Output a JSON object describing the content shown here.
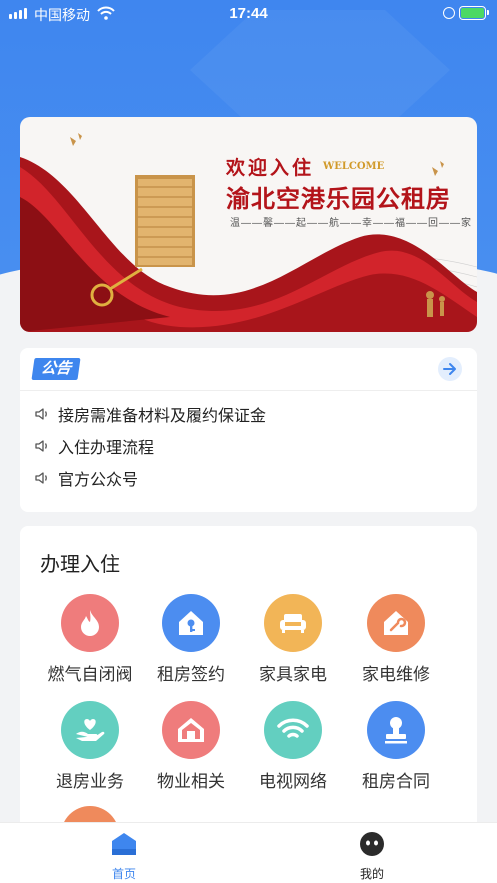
{
  "status_bar": {
    "carrier": "中国移动",
    "time": "17:44"
  },
  "banner": {
    "title_line1": "欢迎入住",
    "welcome_en": "WELCOME",
    "title_line2": "渝北空港乐园公租房",
    "slogan": "温——馨——起——航——幸——福——回——家"
  },
  "notice": {
    "tag": "公告",
    "items": [
      "接房需准备材料及履约保证金",
      "入住办理流程",
      "官方公众号"
    ]
  },
  "services": {
    "heading": "办理入住",
    "items": [
      {
        "label": "燃气自闭阀",
        "icon": "flame-icon",
        "color": "#ef7c7c"
      },
      {
        "label": "租房签约",
        "icon": "house-key-icon",
        "color": "#4c8df0"
      },
      {
        "label": "家具家电",
        "icon": "sofa-icon",
        "color": "#f2b557"
      },
      {
        "label": "家电维修",
        "icon": "house-wrench-icon",
        "color": "#ef8a5c"
      },
      {
        "label": "退房业务",
        "icon": "hand-heart-icon",
        "color": "#63cfc0"
      },
      {
        "label": "物业相关",
        "icon": "building-icon",
        "color": "#ef7c7c"
      },
      {
        "label": "电视网络",
        "icon": "wifi-icon",
        "color": "#63cfc0"
      },
      {
        "label": "租房合同",
        "icon": "stamp-icon",
        "color": "#4c8df0"
      }
    ]
  },
  "tabbar": {
    "home": "首页",
    "mine": "我的",
    "active_color": "#3e86ee"
  }
}
